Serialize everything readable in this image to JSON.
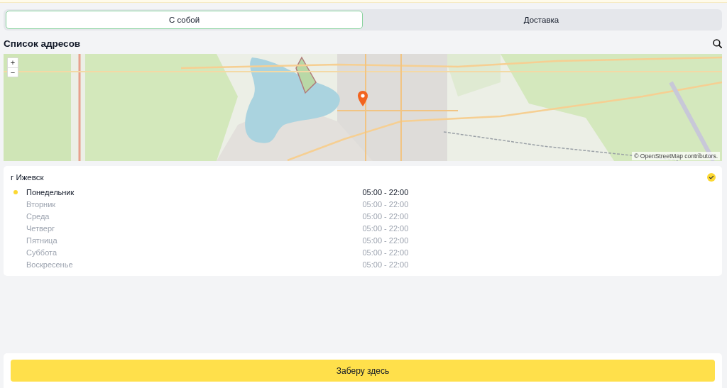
{
  "tabs": [
    {
      "label": "С собой",
      "selected": true
    },
    {
      "label": "Доставка",
      "selected": false
    }
  ],
  "header": {
    "title": "Список адресов"
  },
  "map": {
    "zoom_in": "+",
    "zoom_out": "−",
    "attribution": "© OpenStreetMap contributors."
  },
  "address": {
    "city": "г Ижевск",
    "selected": true,
    "schedule": [
      {
        "day": "Понедельник",
        "hours": "05:00 - 22:00",
        "current": true
      },
      {
        "day": "Вторник",
        "hours": "05:00 - 22:00",
        "current": false
      },
      {
        "day": "Среда",
        "hours": "05:00 - 22:00",
        "current": false
      },
      {
        "day": "Четверг",
        "hours": "05:00 - 22:00",
        "current": false
      },
      {
        "day": "Пятница",
        "hours": "05:00 - 22:00",
        "current": false
      },
      {
        "day": "Суббота",
        "hours": "05:00 - 22:00",
        "current": false
      },
      {
        "day": "Воскресенье",
        "hours": "05:00 - 22:00",
        "current": false
      }
    ]
  },
  "action_button": {
    "label": "Заберу здесь"
  }
}
